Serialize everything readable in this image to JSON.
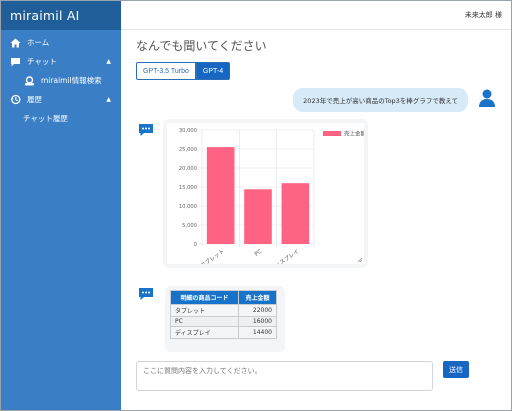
{
  "app": {
    "title": "miraimil AI"
  },
  "header": {
    "user_label": "未来太郎 様"
  },
  "sidebar": {
    "items": [
      {
        "label": "ホーム",
        "icon": "home-icon"
      },
      {
        "label": "チャット",
        "icon": "chat-icon"
      },
      {
        "label": "miraimil情報検索",
        "icon": "search-person-icon"
      },
      {
        "label": "履歴",
        "icon": "history-icon"
      },
      {
        "label": "チャット履歴",
        "icon": ""
      }
    ]
  },
  "main": {
    "title": "なんでも聞いてください",
    "models": [
      {
        "label": "GPT-3.5 Turbo",
        "selected": false
      },
      {
        "label": "GPT-4",
        "selected": true
      }
    ],
    "user_message": "2023年で売上が高い商品のTop3を棒グラフで教えて",
    "composer": {
      "placeholder": "ここに質問内容を入力してください。",
      "send_label": "送信"
    }
  },
  "colors": {
    "sidebar": "#3a7fc5",
    "brand": "#1f5e99",
    "accent": "#1766c2",
    "bar": "#ff6384",
    "bubble": "#d6eaf8"
  },
  "chart_data": {
    "type": "bar",
    "categories": [
      "タブレット",
      "PC",
      "ディスプレイ"
    ],
    "series": [
      {
        "name": "売上金額",
        "values": [
          25500,
          14400,
          16000
        ]
      }
    ],
    "ylim": [
      0,
      30000
    ],
    "yticks": [
      "0",
      "5,000",
      "10,000",
      "15,000",
      "20,000",
      "25,000",
      "30,000"
    ],
    "grid": true,
    "legend": "top-right",
    "color": "#ff6384"
  },
  "table": {
    "headers": [
      "明細の商品コード",
      "売上金額"
    ],
    "rows": [
      [
        "タブレット",
        "22000"
      ],
      [
        "PC",
        "16000"
      ],
      [
        "ディスプレイ",
        "14400"
      ]
    ]
  }
}
